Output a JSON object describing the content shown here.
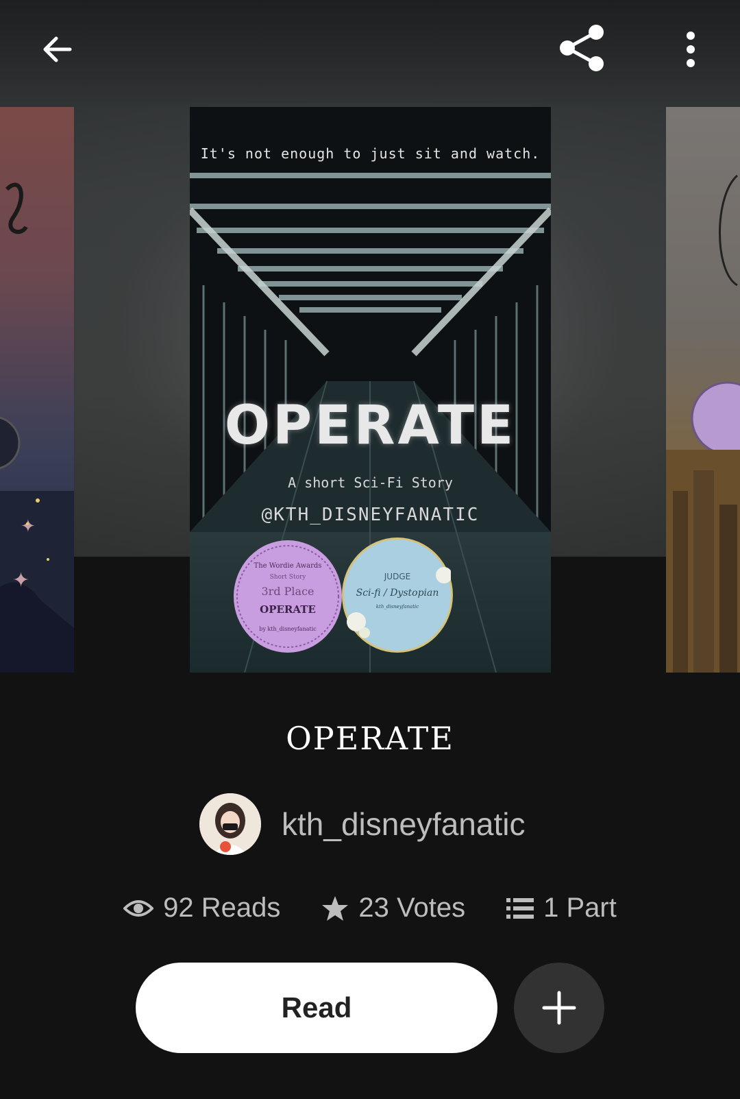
{
  "header": {
    "back_icon": "arrow-left-icon",
    "share_icon": "share-icon",
    "more_icon": "more-vertical-icon"
  },
  "cover": {
    "tagline": "It's not enough to just sit and watch.",
    "title": "OPERATE",
    "subtitle": "A short Sci-Fi Story",
    "handle": "@KTH_DISNEYFANATIC",
    "badge_left": [
      "The Wordie Awards",
      "Short Story",
      "3rd Place",
      "OPERATE",
      "by kth_disneyfanatic"
    ],
    "badge_right": [
      "JUDGE",
      "Sci-fi / Dystopian",
      "kth_disneyfanatic"
    ]
  },
  "story": {
    "title": "OPERATE",
    "author": "kth_disneyfanatic"
  },
  "stats": {
    "reads": "92 Reads",
    "votes": "23 Votes",
    "parts": "1 Part"
  },
  "actions": {
    "read_label": "Read",
    "add_icon": "plus-icon"
  },
  "colors": {
    "background": "#121212",
    "read_button": "#ffffff",
    "add_button": "#323232",
    "muted_text": "#bdbdbd"
  }
}
